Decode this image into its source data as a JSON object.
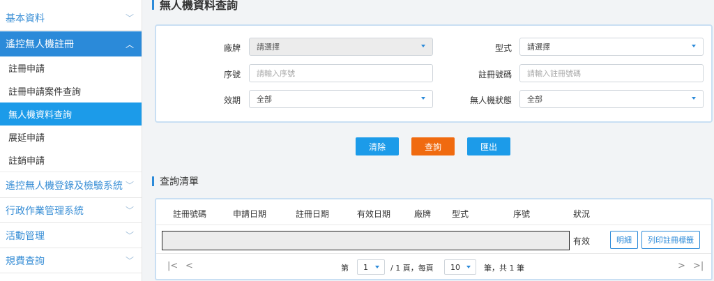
{
  "sidebar": {
    "basic": "基本資料",
    "drone_reg": "遙控無人機註冊",
    "sub": [
      "註冊申請",
      "註冊申請案件查詢",
      "無人機資料查詢",
      "展延申請",
      "註銷申請"
    ],
    "login_test": "遙控無人機登錄及檢驗系統",
    "admin": "行政作業管理系統",
    "activity": "活動管理",
    "fee": "規費查詢",
    "chevron_down": "﹀",
    "chevron_up": "︿"
  },
  "main": {
    "title": "無人機資料查詢",
    "filters": {
      "brand_label": "廠牌",
      "brand_value": "請選擇",
      "model_label": "型式",
      "model_value": "請選擇",
      "serial_label": "序號",
      "serial_placeholder": "請輸入序號",
      "regno_label": "註冊號碼",
      "regno_placeholder": "請輸入註冊號碼",
      "period_label": "效期",
      "period_value": "全部",
      "status_label": "無人機狀態",
      "status_value": "全部"
    },
    "buttons": {
      "clear": "清除",
      "search": "查詢",
      "export": "匯出"
    },
    "list_title": "查詢清單",
    "table": {
      "headers": [
        "註冊號碼",
        "申請日期",
        "註冊日期",
        "有效日期",
        "廠牌",
        "型式",
        "序號",
        "狀況"
      ],
      "rows": [
        {
          "status": "有效",
          "detail": "明細",
          "print": "列印註冊標籤"
        }
      ]
    },
    "pager": {
      "first": "|<",
      "prev": "<",
      "next": ">",
      "last": ">|",
      "page_prefix": "第",
      "page": "1",
      "page_suffix": "/ 1 頁，每頁",
      "per_page": "10",
      "total": "筆，共 1 筆"
    }
  }
}
